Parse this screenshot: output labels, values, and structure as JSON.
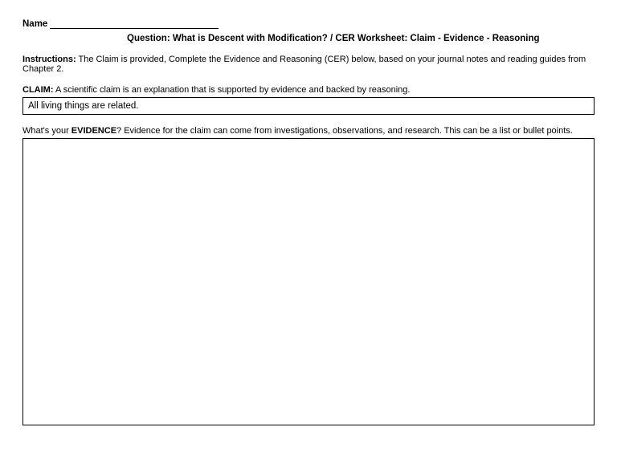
{
  "name": {
    "label": "Name"
  },
  "title": "Question:  What is Descent with Modification? / CER Worksheet: Claim - Evidence - Reasoning",
  "instructions": {
    "label": "Instructions:",
    "text": " The Claim is provided, Complete the Evidence and Reasoning (CER) below, based on your journal notes and reading guides from Chapter 2."
  },
  "claim": {
    "label": "CLAIM:",
    "desc": " A scientific claim is an explanation that is supported by evidence and backed by reasoning.",
    "value": "All living things are related."
  },
  "evidence": {
    "pre": "What's your ",
    "label": "EVIDENCE",
    "desc": "? Evidence for the claim can come from investigations, observations, and research.  This can be a list or bullet points."
  }
}
